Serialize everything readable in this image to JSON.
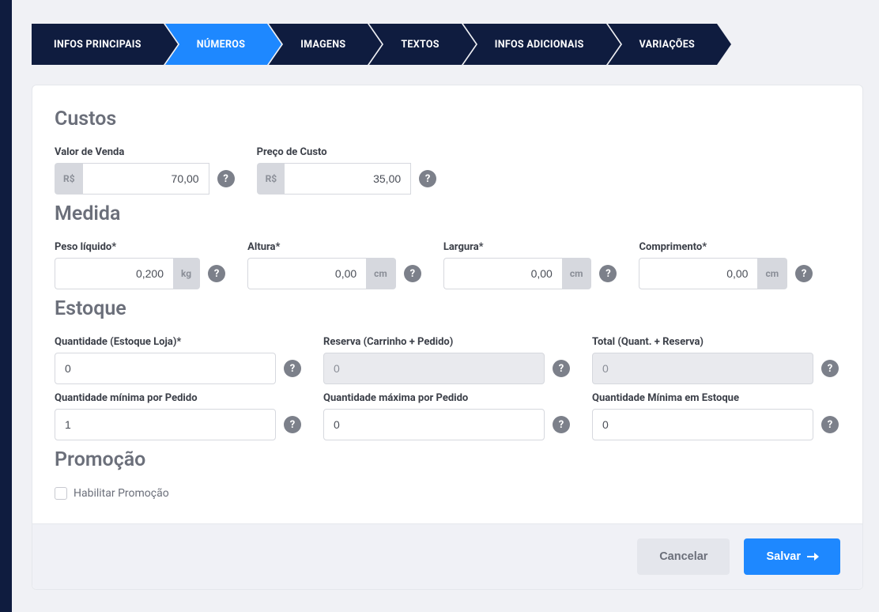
{
  "breadcrumb": {
    "items": [
      {
        "label": "INFOS PRINCIPAIS"
      },
      {
        "label": "NÚMEROS"
      },
      {
        "label": "IMAGENS"
      },
      {
        "label": "TEXTOS"
      },
      {
        "label": "INFOS ADICIONAIS"
      },
      {
        "label": "VARIAÇÕES"
      }
    ],
    "active_index": 1
  },
  "sections": {
    "custos": {
      "title": "Custos",
      "valor_venda": {
        "label": "Valor de Venda",
        "prefix": "R$",
        "value": "70,00"
      },
      "preco_custo": {
        "label": "Preço de Custo",
        "prefix": "R$",
        "value": "35,00"
      }
    },
    "medida": {
      "title": "Medida",
      "peso": {
        "label": "Peso líquido*",
        "suffix": "kg",
        "value": "0,200"
      },
      "altura": {
        "label": "Altura*",
        "suffix": "cm",
        "value": "0,00"
      },
      "largura": {
        "label": "Largura*",
        "suffix": "cm",
        "value": "0,00"
      },
      "comprimento": {
        "label": "Comprimento*",
        "suffix": "cm",
        "value": "0,00"
      }
    },
    "estoque": {
      "title": "Estoque",
      "quantidade": {
        "label": "Quantidade (Estoque Loja)*",
        "value": "0"
      },
      "reserva": {
        "label": "Reserva (Carrinho + Pedido)",
        "value": "0"
      },
      "total": {
        "label": "Total (Quant. + Reserva)",
        "value": "0"
      },
      "min_pedido": {
        "label": "Quantidade mínima por Pedido",
        "value": "1"
      },
      "max_pedido": {
        "label": "Quantidade máxima por Pedido",
        "value": "0"
      },
      "min_estoque": {
        "label": "Quantidade Mínima em Estoque",
        "value": "0"
      }
    },
    "promocao": {
      "title": "Promoção",
      "habilitar": {
        "label": "Habilitar Promoção",
        "checked": false
      }
    }
  },
  "footer": {
    "cancel": "Cancelar",
    "save": "Salvar"
  },
  "help_glyph": "?"
}
